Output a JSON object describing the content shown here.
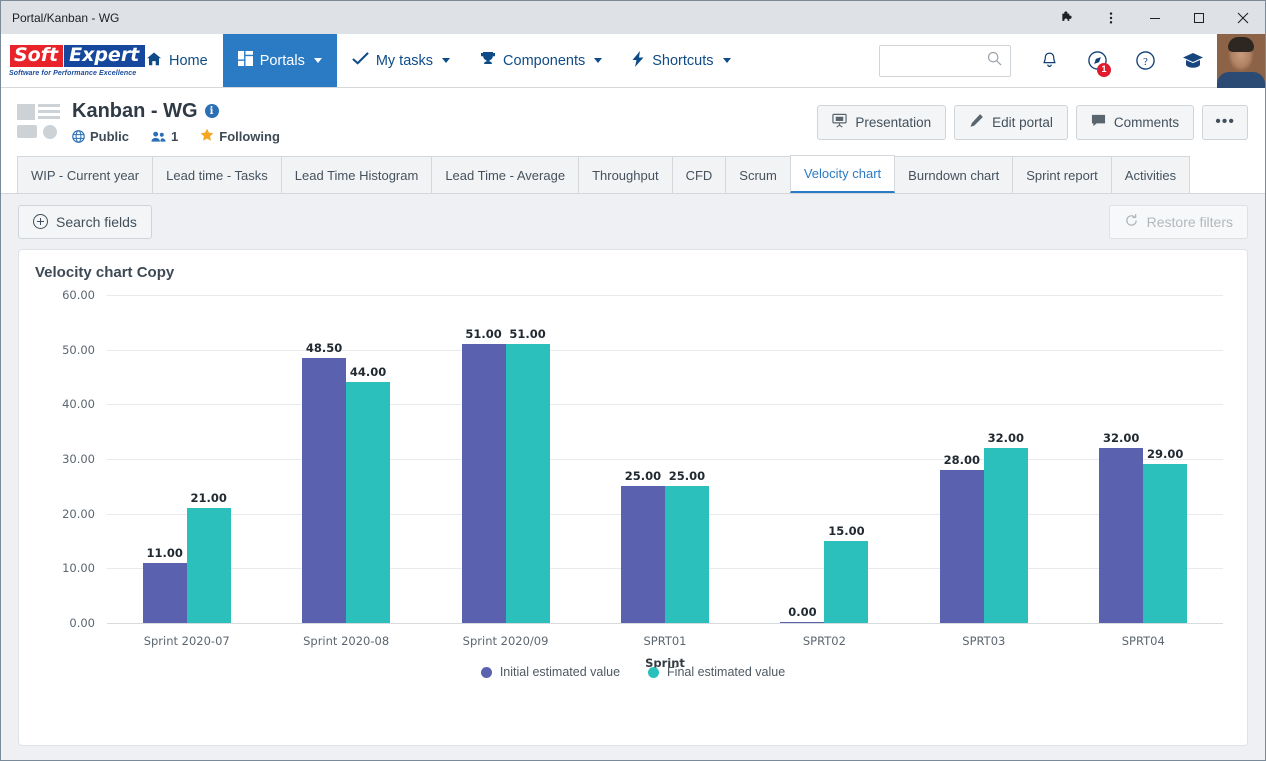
{
  "window": {
    "title": "Portal/Kanban - WG",
    "controls": {
      "extensions": "puzzle-icon",
      "menu": "kebab-menu-icon",
      "minimize": "minimize",
      "maximize": "maximize",
      "close": "close"
    }
  },
  "topnav": {
    "logo_primary": "Soft",
    "logo_secondary": "Expert",
    "logo_tagline": "Software for Performance Excellence",
    "items": [
      {
        "label": "Home",
        "icon": "home-icon",
        "caret": false,
        "active": false
      },
      {
        "label": "Portals",
        "icon": "grid-icon",
        "caret": true,
        "active": true
      },
      {
        "label": "My tasks",
        "icon": "check-icon",
        "caret": true,
        "active": false
      },
      {
        "label": "Components",
        "icon": "trophy-icon",
        "caret": true,
        "active": false
      },
      {
        "label": "Shortcuts",
        "icon": "bolt-icon",
        "caret": true,
        "active": false
      }
    ],
    "search": {
      "value": "",
      "placeholder": ""
    },
    "icons": [
      {
        "name": "bell-icon",
        "badge": ""
      },
      {
        "name": "compass-icon",
        "badge": "1"
      },
      {
        "name": "help-icon",
        "badge": ""
      },
      {
        "name": "academy-icon",
        "badge": ""
      }
    ],
    "avatar": "user-avatar"
  },
  "portal": {
    "title": "Kanban - WG",
    "info_icon": "i",
    "visibility": "Public",
    "members_count": "1",
    "following": "Following",
    "actions": [
      {
        "label": "Presentation",
        "icon": "presentation-icon"
      },
      {
        "label": "Edit portal",
        "icon": "pencil-icon"
      },
      {
        "label": "Comments",
        "icon": "comment-icon"
      }
    ],
    "more_label": "•••"
  },
  "tabs": [
    {
      "label": "WIP - Current year",
      "active": false
    },
    {
      "label": "Lead time - Tasks",
      "active": false
    },
    {
      "label": "Lead Time Histogram",
      "active": false
    },
    {
      "label": "Lead Time - Average",
      "active": false
    },
    {
      "label": "Throughput",
      "active": false
    },
    {
      "label": "CFD",
      "active": false
    },
    {
      "label": "Scrum",
      "active": false
    },
    {
      "label": "Velocity chart",
      "active": true
    },
    {
      "label": "Burndown chart",
      "active": false
    },
    {
      "label": "Sprint report",
      "active": false
    },
    {
      "label": "Activities",
      "active": false
    }
  ],
  "filterbar": {
    "search_fields_label": "Search fields",
    "restore_filters_label": "Restore filters"
  },
  "chart_data": {
    "type": "bar",
    "title": "Velocity chart Copy",
    "xlabel": "Sprint",
    "ylabel": "",
    "ylim": [
      0,
      60
    ],
    "yticks": [
      "0.00",
      "10.00",
      "20.00",
      "30.00",
      "40.00",
      "50.00",
      "60.00"
    ],
    "grid": true,
    "legend_position": "bottom",
    "categories": [
      "Sprint 2020-07",
      "Sprint 2020-08",
      "Sprint 2020/09",
      "SPRT01",
      "SPRT02",
      "SPRT03",
      "SPRT04"
    ],
    "series": [
      {
        "name": "Initial estimated value",
        "color": "#5a61af",
        "values": [
          11.0,
          48.5,
          51.0,
          25.0,
          0.0,
          28.0,
          32.0
        ],
        "labels": [
          "11.00",
          "48.50",
          "51.00",
          "25.00",
          "0.00",
          "28.00",
          "32.00"
        ]
      },
      {
        "name": "Final estimated value",
        "color": "#2bc0bc",
        "values": [
          21.0,
          44.0,
          51.0,
          25.0,
          15.0,
          32.0,
          29.0
        ],
        "labels": [
          "21.00",
          "44.00",
          "51.00",
          "25.00",
          "15.00",
          "32.00",
          "29.00"
        ]
      }
    ]
  }
}
